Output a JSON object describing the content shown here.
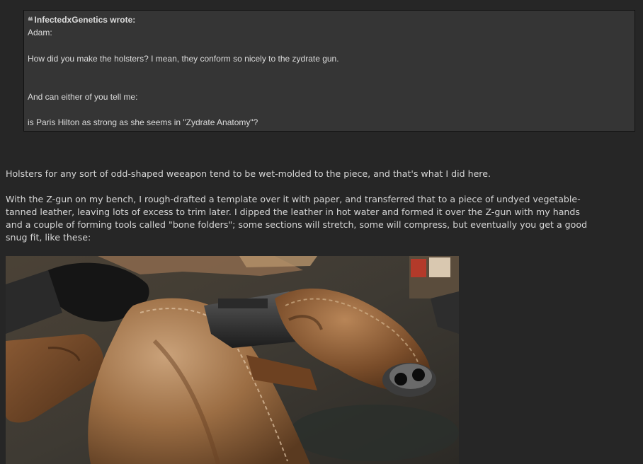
{
  "quote": {
    "author_line": "InfectedxGenetics wrote:",
    "icon": "quote-icon",
    "lines": [
      "Adam:",
      "How did you make the holsters? I mean, they conform so nicely to the zydrate gun.",
      "And can either of you tell me:",
      "is Paris Hilton as strong as she seems in \"Zydrate Anatomy\"?"
    ]
  },
  "post": {
    "paragraph_1": "Holsters for any sort of odd-shaped weeapon tend to be wet-molded to the piece, and that's what I did here.",
    "paragraph_2_lines": [
      "With the Z-gun on my bench, I rough-drafted a template over it with paper, and transferred that to a piece of undyed vegetable-",
      "tanned leather, leaving lots of excess to trim later. I dipped the leather in hot water and formed it over the Z-gun with my hands",
      "and a couple of forming tools called \"bone folders\"; some sections will stretch, some will compress, but eventually you get a good",
      "snug fit, like these:"
    ]
  },
  "colors": {
    "background": "#262626",
    "quote_background": "#353535",
    "text": "#d6d6d6"
  }
}
